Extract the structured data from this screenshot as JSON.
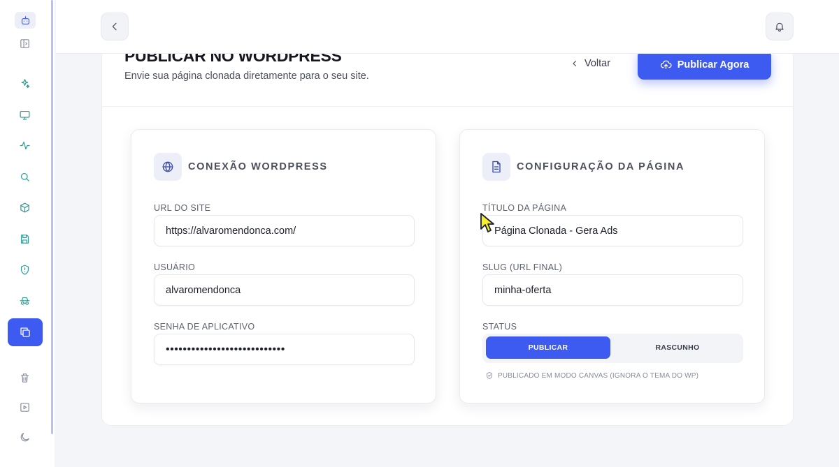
{
  "header": {
    "title": "PUBLICAR NO WORDPRESS",
    "subtitle": "Envie sua página clonada diretamente para o seu site.",
    "back_label": "Voltar",
    "publish_label": "Publicar Agora"
  },
  "connection": {
    "title": "CONEXÃO WORDPRESS",
    "url_label": "URL DO SITE",
    "url_value": "https://alvaromendonca.com/",
    "user_label": "USUÁRIO",
    "user_value": "alvaromendonca",
    "password_label": "SENHA DE APLICATIVO",
    "password_value": "••••••••••••••••••••••••••••"
  },
  "page_config": {
    "title": "CONFIGURAÇÃO DA PÁGINA",
    "page_title_label": "TÍTULO DA PÁGINA",
    "page_title_value": "Página Clonada - Gera Ads",
    "slug_label": "SLUG (URL FINAL)",
    "slug_value": "minha-oferta",
    "status_label": "STATUS",
    "status_options": [
      "PUBLICAR",
      "RASCUNHO"
    ],
    "status_selected": "PUBLICAR",
    "canvas_note": "PUBLICADO EM MODO CANVAS (IGNORA O TEMA DO WP)"
  },
  "sidebar": {
    "icons": [
      "bot-icon",
      "panel-toggle-icon",
      "sparkles-icon",
      "monitor-icon",
      "activity-icon",
      "search-icon",
      "box-icon",
      "save-icon",
      "shield-icon",
      "spy-icon",
      "copy-icon",
      "trash-icon",
      "video-icon",
      "moon-icon"
    ],
    "active": "copy-icon"
  },
  "colors": {
    "accent": "#3d5af1",
    "sidebar_icon": "#2f9a91",
    "background": "#f4f5f9"
  }
}
